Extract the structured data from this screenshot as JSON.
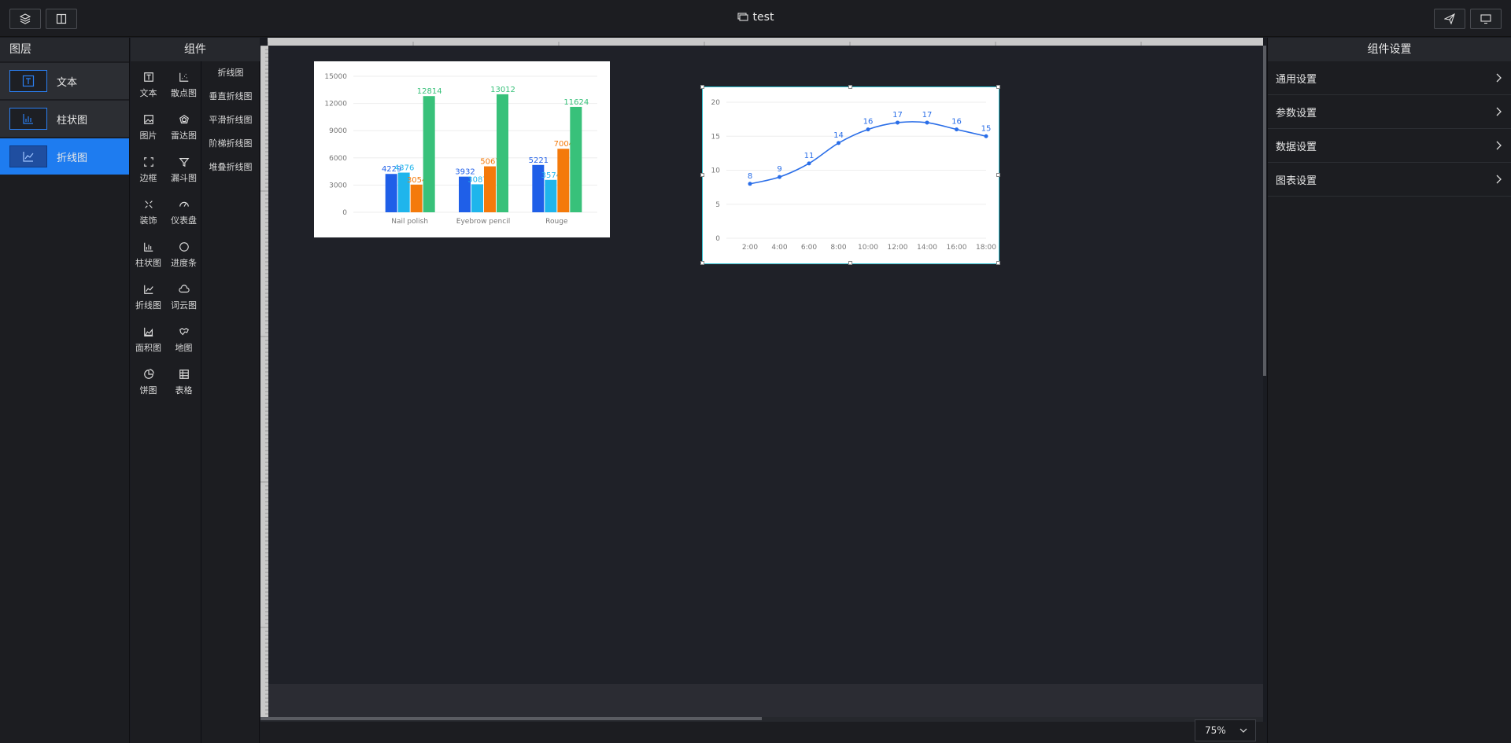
{
  "window": {
    "title": "test"
  },
  "layers": {
    "heading": "图层",
    "items": [
      {
        "label": "文本",
        "icon": "text-icon",
        "active": false
      },
      {
        "label": "柱状图",
        "icon": "bar-chart-icon",
        "active": false
      },
      {
        "label": "折线图",
        "icon": "line-chart-icon",
        "active": true
      }
    ]
  },
  "components": {
    "heading": "组件",
    "items": [
      {
        "label": "文本",
        "icon": "text-icon"
      },
      {
        "label": "散点图",
        "icon": "scatter-icon"
      },
      {
        "label": "图片",
        "icon": "image-icon"
      },
      {
        "label": "雷达图",
        "icon": "radar-icon"
      },
      {
        "label": "边框",
        "icon": "border-icon"
      },
      {
        "label": "漏斗图",
        "icon": "funnel-icon"
      },
      {
        "label": "装饰",
        "icon": "decoration-icon"
      },
      {
        "label": "仪表盘",
        "icon": "gauge-icon"
      },
      {
        "label": "柱状图",
        "icon": "bar-chart-icon"
      },
      {
        "label": "进度条",
        "icon": "progress-icon"
      },
      {
        "label": "折线图",
        "icon": "line-chart-icon"
      },
      {
        "label": "词云图",
        "icon": "wordcloud-icon"
      },
      {
        "label": "面积图",
        "icon": "area-chart-icon"
      },
      {
        "label": "地图",
        "icon": "map-icon"
      },
      {
        "label": "饼图",
        "icon": "pie-chart-icon"
      },
      {
        "label": "表格",
        "icon": "table-icon"
      }
    ],
    "sub_items": [
      "折线图",
      "垂直折线图",
      "平滑折线图",
      "阶梯折线图",
      "堆叠折线图"
    ]
  },
  "settings": {
    "heading": "组件设置",
    "rows": [
      "通用设置",
      "参数设置",
      "数据设置",
      "图表设置"
    ]
  },
  "zoom": {
    "value": "75%"
  },
  "colors": {
    "accent": "#1e7cf0",
    "bar1": "#1f5fe8",
    "bar2": "#1fb5ec",
    "bar3": "#f47a0b",
    "bar4": "#38c17a",
    "line": "#2a6ee8"
  },
  "chart_data": [
    {
      "type": "bar",
      "title": "",
      "categories": [
        "Nail polish",
        "Eyebrow pencil",
        "Rouge"
      ],
      "series": [
        {
          "values": [
            4229,
            3932,
            5221
          ]
        },
        {
          "values": [
            4376,
            3087,
            3574
          ]
        },
        {
          "values": [
            3054,
            5067,
            7004
          ]
        },
        {
          "values": [
            12814,
            13012,
            11624
          ]
        }
      ],
      "ylim": [
        0,
        15000
      ],
      "yticks": [
        0,
        3000,
        6000,
        9000,
        12000,
        15000
      ],
      "grid": true
    },
    {
      "type": "line",
      "title": "",
      "x": [
        "2:00",
        "4:00",
        "6:00",
        "8:00",
        "10:00",
        "12:00",
        "14:00",
        "16:00",
        "18:00"
      ],
      "series": [
        {
          "values": [
            8,
            9,
            11,
            14,
            16,
            17,
            17,
            16,
            15
          ]
        }
      ],
      "ylim": [
        0,
        20
      ],
      "yticks": [
        0,
        5,
        10,
        15,
        20
      ],
      "smooth": true,
      "grid": true
    }
  ]
}
